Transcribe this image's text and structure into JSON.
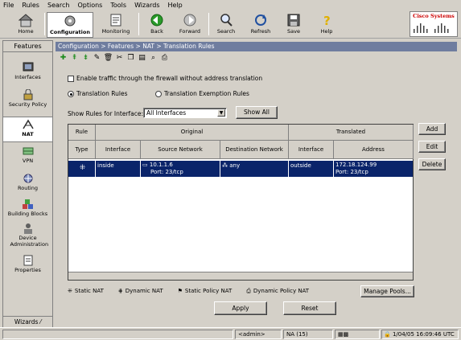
{
  "menu": [
    "File",
    "Rules",
    "Search",
    "Options",
    "Tools",
    "Wizards",
    "Help"
  ],
  "toolbar": {
    "home": "Home",
    "configuration": "Configuration",
    "monitoring": "Monitoring",
    "back": "Back",
    "forward": "Forward",
    "search": "Search",
    "refresh": "Refresh",
    "save": "Save",
    "help": "Help"
  },
  "logo": "Cisco Systems",
  "features": {
    "header": "Features",
    "interfaces": "Interfaces",
    "security_policy": "Security Policy",
    "nat": "NAT",
    "vpn": "VPN",
    "routing": "Routing",
    "building_blocks": "Building Blocks",
    "device_admin": "Device Administration",
    "properties": "Properties",
    "wizards": "Wizards"
  },
  "breadcrumb": "Configuration > Features > NAT > Translation Rules",
  "enable_traffic_label": "Enable traffic through the firewall without address translation",
  "radio_translation_rules": "Translation Rules",
  "radio_translation_exemption": "Translation Exemption Rules",
  "show_rules_label": "Show Rules for Interface:",
  "interface_select_value": "All Interfaces",
  "show_all_button": "Show All",
  "table": {
    "group_headers": {
      "rule": "Rule",
      "original": "Original",
      "translated": "Translated"
    },
    "columns": [
      "Type",
      "Interface",
      "Source Network",
      "Destination Network",
      "Interface",
      "Address"
    ],
    "row": {
      "orig_interface": "inside",
      "source_network": "10.1.1.6",
      "source_port": "Port: 23/tcp",
      "destination": "any",
      "trans_interface": "outside",
      "address": "172.18.124.99",
      "address_port": "Port: 23/tcp"
    }
  },
  "side_buttons": {
    "add": "Add",
    "edit": "Edit",
    "delete": "Delete"
  },
  "legend": {
    "static_nat": "Static NAT",
    "dynamic_nat": "Dynamic NAT",
    "static_policy_nat": "Static Policy NAT",
    "dynamic_policy_nat": "Dynamic Policy NAT"
  },
  "manage_pools": "Manage Pools...",
  "apply": "Apply",
  "reset": "Reset",
  "status": {
    "user": "<admin>",
    "na": "NA (15)",
    "datetime": "1/04/05 16:09:46 UTC"
  },
  "colors": {
    "selected_row": "#0a246a",
    "breadcrumb": "#6f7d9f",
    "logo_red": "#cc0000"
  }
}
